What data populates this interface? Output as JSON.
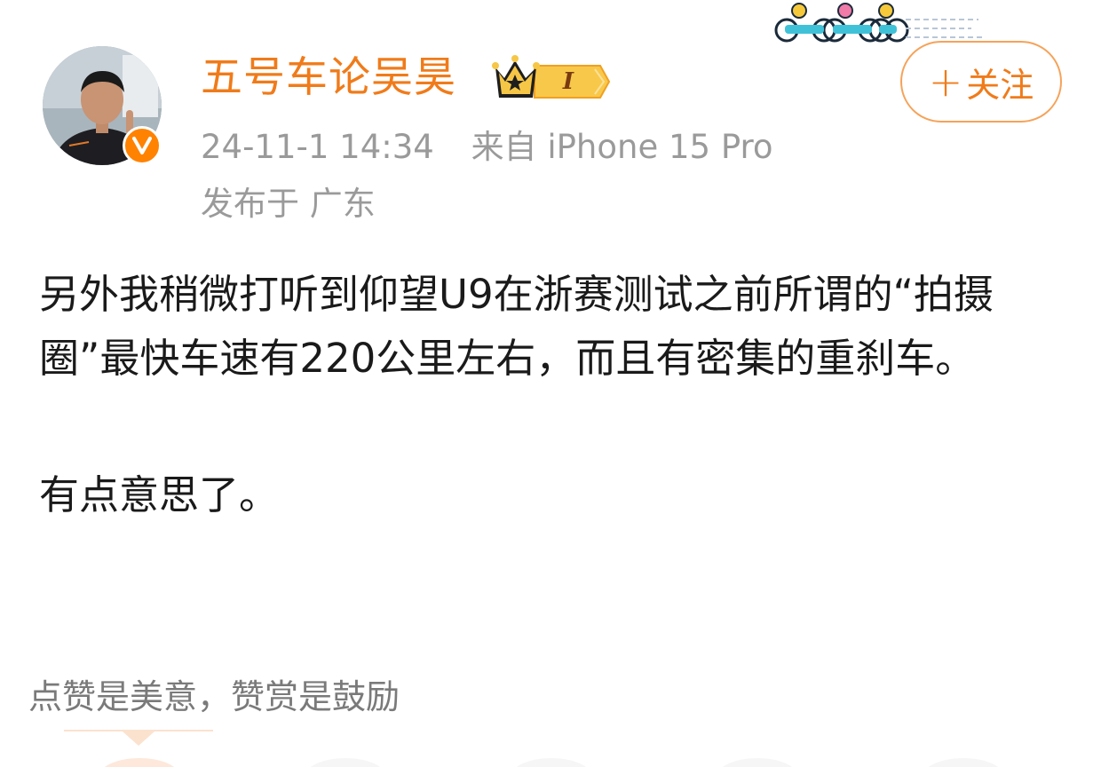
{
  "post": {
    "author": {
      "name": "五号车论吴昊",
      "avatar_icon": "user-avatar",
      "verified_icon": "verified-v-icon",
      "member_badge_icon": "crown-member-badge-icon",
      "member_level": "I"
    },
    "follow_button": {
      "label": "关注",
      "plus_glyph": "+"
    },
    "meta": {
      "timestamp": "24-11-1 14:34",
      "source": "来自 iPhone 15 Pro",
      "location": "发布于 广东"
    },
    "content": {
      "paragraphs": [
        "另外我稍微打听到仰望U9在浙赛测试之前所谓的“拍摄圈”最快车速有220公里左右，而且有密集的重刹车。",
        "有点意思了。"
      ]
    },
    "reward": {
      "text": "点赞是美意，赞赏是鼓励"
    },
    "colors": {
      "accent": "#f07b1a",
      "meta_text": "#9a9a9a",
      "body_text": "#1a1a1a",
      "verified": "#ff8200"
    }
  }
}
